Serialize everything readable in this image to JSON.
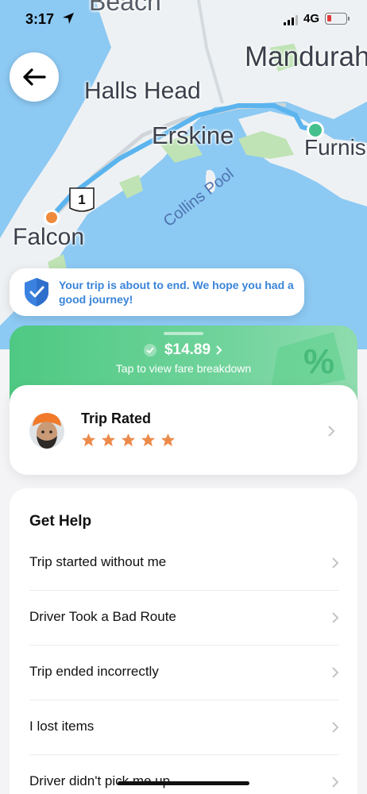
{
  "status_bar": {
    "time": "3:17",
    "network": "4G"
  },
  "map": {
    "labels": {
      "beach": "Beach",
      "mandurah": "Mandurah",
      "halls_head": "Halls Head",
      "erskine": "Erskine",
      "furnissdale": "Furnis",
      "falcon": "Falcon",
      "collins_pool": "Collins Pool"
    },
    "route_shield": "1",
    "colors": {
      "water": "#8cc9f3",
      "land": "#eef1f3",
      "park": "#bfe3b4",
      "route": "#5bb4ee",
      "origin": "#ee8a3c",
      "destination": "#45c08d"
    }
  },
  "toast": {
    "message": "Your trip is about to end. We hope you had a good journey!"
  },
  "fare": {
    "amount": "$14.89",
    "subtitle": "Tap to view fare breakdown"
  },
  "rating": {
    "title": "Trip Rated",
    "stars": 5,
    "star_color": "#ec8a4a"
  },
  "help": {
    "title": "Get Help",
    "items": [
      {
        "label": "Trip started without me"
      },
      {
        "label": "Driver Took a Bad Route"
      },
      {
        "label": "Trip ended incorrectly"
      },
      {
        "label": "I lost items"
      },
      {
        "label": "Driver didn't pick me up"
      }
    ]
  }
}
